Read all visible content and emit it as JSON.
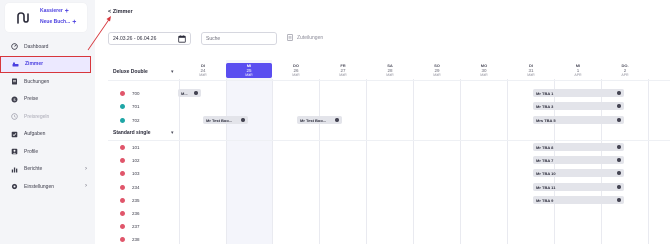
{
  "brand": {
    "cashier_label": "Kassierer",
    "new_booking_label": "Neue Buch..."
  },
  "sidebar": {
    "items": [
      {
        "label": "Dashboard",
        "icon": "dashboard-icon"
      },
      {
        "label": "Zimmer",
        "icon": "bed-icon"
      },
      {
        "label": "Buchungen",
        "icon": "bookings-icon"
      },
      {
        "label": "Preise",
        "icon": "prices-icon"
      },
      {
        "label": "Preisregeln",
        "icon": "price-rules-icon"
      },
      {
        "label": "Aufgaben",
        "icon": "tasks-icon"
      },
      {
        "label": "Profile",
        "icon": "profile-icon"
      },
      {
        "label": "Berichte",
        "icon": "reports-icon"
      },
      {
        "label": "Einstellungen",
        "icon": "settings-icon"
      }
    ]
  },
  "page": {
    "title": "< Zimmer",
    "date_range": "24.03.26 - 06.04.26",
    "search_placeholder": "Suche",
    "assign_label": "Zuteilungen"
  },
  "colors": {
    "accent": "#5a4ef0",
    "dot_red": "#e0566b",
    "dot_teal": "#1fa6a6",
    "annotation": "#d7363c"
  },
  "days": [
    {
      "dow": "DI",
      "num": "24",
      "mon": "MäR"
    },
    {
      "dow": "MI",
      "num": "25",
      "mon": "MäR",
      "today": true
    },
    {
      "dow": "DO",
      "num": "26",
      "mon": "MäR"
    },
    {
      "dow": "FR",
      "num": "27",
      "mon": "MäR"
    },
    {
      "dow": "SA",
      "num": "28",
      "mon": "MäR"
    },
    {
      "dow": "SO",
      "num": "29",
      "mon": "MäR"
    },
    {
      "dow": "MO",
      "num": "30",
      "mon": "MäR"
    },
    {
      "dow": "DI",
      "num": "31",
      "mon": "MäR"
    },
    {
      "dow": "MI",
      "num": "1",
      "mon": "APR"
    },
    {
      "dow": "DO.",
      "num": "2",
      "mon": "APR"
    }
  ],
  "groups": [
    {
      "label": "Deluxe Double"
    },
    {
      "label": "Standard single"
    }
  ],
  "rooms": [
    {
      "num": "700",
      "dot": "red"
    },
    {
      "num": "701",
      "dot": "teal"
    },
    {
      "num": "702",
      "dot": "teal"
    },
    {
      "num": "101",
      "dot": "red"
    },
    {
      "num": "102",
      "dot": "red"
    },
    {
      "num": "103",
      "dot": "red"
    },
    {
      "num": "234",
      "dot": "red"
    },
    {
      "num": "235",
      "dot": "red"
    },
    {
      "num": "236",
      "dot": "red"
    },
    {
      "num": "237",
      "dot": "red"
    },
    {
      "num": "238",
      "dot": "red"
    }
  ],
  "bookings": [
    {
      "label": "M..."
    },
    {
      "label": "Mr TBA 1"
    },
    {
      "label": "Mr TBA 3"
    },
    {
      "label": "Mr Test Boo..."
    },
    {
      "label": "Mr Test Boo..."
    },
    {
      "label": "Mrs TBA 5"
    },
    {
      "label": "Mr TBA 8"
    },
    {
      "label": "Mr TBA 7"
    },
    {
      "label": "Mr TBA 10"
    },
    {
      "label": "Mr TBA 11"
    },
    {
      "label": "Mr TBA 9"
    }
  ]
}
